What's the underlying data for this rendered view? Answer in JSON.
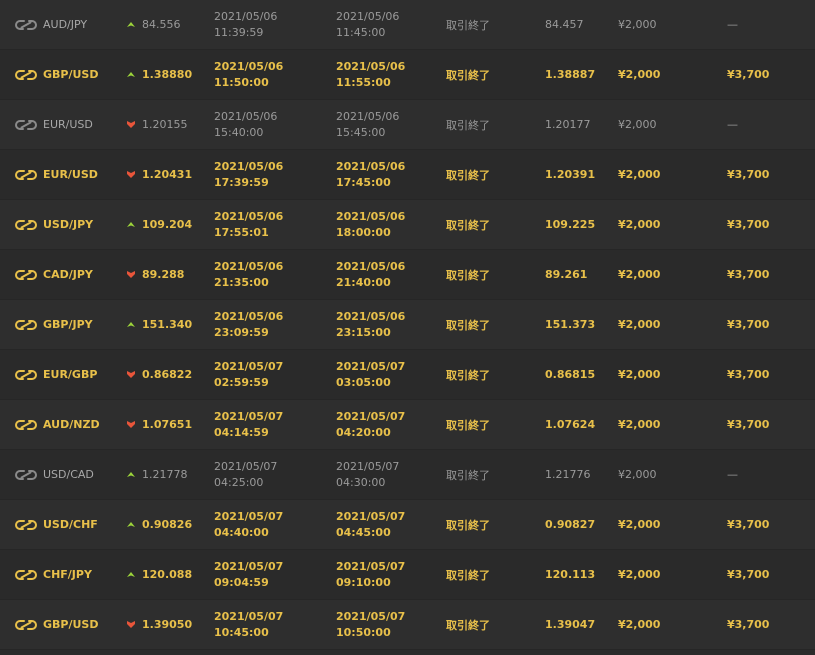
{
  "colors": {
    "background": "#2b2b2b",
    "win_text": "#e8c04a",
    "lose_text": "#9a9a9a",
    "up_arrow": "#9cd43a",
    "down_arrow": "#e8553a"
  },
  "rows": [
    {
      "result": "lose",
      "pair": "AUD/JPY",
      "direction": "up",
      "entry_rate": "84.556",
      "entry_date": "2021/05/06",
      "entry_time": "11:39:59",
      "expiry_date": "2021/05/06",
      "expiry_time": "11:45:00",
      "status": "取引終了",
      "close_rate": "84.457",
      "amount": "¥2,000",
      "payout": "—"
    },
    {
      "result": "win",
      "pair": "GBP/USD",
      "direction": "up",
      "entry_rate": "1.38880",
      "entry_date": "2021/05/06",
      "entry_time": "11:50:00",
      "expiry_date": "2021/05/06",
      "expiry_time": "11:55:00",
      "status": "取引終了",
      "close_rate": "1.38887",
      "amount": "¥2,000",
      "payout": "¥3,700"
    },
    {
      "result": "lose",
      "pair": "EUR/USD",
      "direction": "down",
      "entry_rate": "1.20155",
      "entry_date": "2021/05/06",
      "entry_time": "15:40:00",
      "expiry_date": "2021/05/06",
      "expiry_time": "15:45:00",
      "status": "取引終了",
      "close_rate": "1.20177",
      "amount": "¥2,000",
      "payout": "—"
    },
    {
      "result": "win",
      "pair": "EUR/USD",
      "direction": "down",
      "entry_rate": "1.20431",
      "entry_date": "2021/05/06",
      "entry_time": "17:39:59",
      "expiry_date": "2021/05/06",
      "expiry_time": "17:45:00",
      "status": "取引終了",
      "close_rate": "1.20391",
      "amount": "¥2,000",
      "payout": "¥3,700"
    },
    {
      "result": "win",
      "pair": "USD/JPY",
      "direction": "up",
      "entry_rate": "109.204",
      "entry_date": "2021/05/06",
      "entry_time": "17:55:01",
      "expiry_date": "2021/05/06",
      "expiry_time": "18:00:00",
      "status": "取引終了",
      "close_rate": "109.225",
      "amount": "¥2,000",
      "payout": "¥3,700"
    },
    {
      "result": "win",
      "pair": "CAD/JPY",
      "direction": "down",
      "entry_rate": "89.288",
      "entry_date": "2021/05/06",
      "entry_time": "21:35:00",
      "expiry_date": "2021/05/06",
      "expiry_time": "21:40:00",
      "status": "取引終了",
      "close_rate": "89.261",
      "amount": "¥2,000",
      "payout": "¥3,700"
    },
    {
      "result": "win",
      "pair": "GBP/JPY",
      "direction": "up",
      "entry_rate": "151.340",
      "entry_date": "2021/05/06",
      "entry_time": "23:09:59",
      "expiry_date": "2021/05/06",
      "expiry_time": "23:15:00",
      "status": "取引終了",
      "close_rate": "151.373",
      "amount": "¥2,000",
      "payout": "¥3,700"
    },
    {
      "result": "win",
      "pair": "EUR/GBP",
      "direction": "down",
      "entry_rate": "0.86822",
      "entry_date": "2021/05/07",
      "entry_time": "02:59:59",
      "expiry_date": "2021/05/07",
      "expiry_time": "03:05:00",
      "status": "取引終了",
      "close_rate": "0.86815",
      "amount": "¥2,000",
      "payout": "¥3,700"
    },
    {
      "result": "win",
      "pair": "AUD/NZD",
      "direction": "down",
      "entry_rate": "1.07651",
      "entry_date": "2021/05/07",
      "entry_time": "04:14:59",
      "expiry_date": "2021/05/07",
      "expiry_time": "04:20:00",
      "status": "取引終了",
      "close_rate": "1.07624",
      "amount": "¥2,000",
      "payout": "¥3,700"
    },
    {
      "result": "lose",
      "pair": "USD/CAD",
      "direction": "up",
      "entry_rate": "1.21778",
      "entry_date": "2021/05/07",
      "entry_time": "04:25:00",
      "expiry_date": "2021/05/07",
      "expiry_time": "04:30:00",
      "status": "取引終了",
      "close_rate": "1.21776",
      "amount": "¥2,000",
      "payout": "—"
    },
    {
      "result": "win",
      "pair": "USD/CHF",
      "direction": "up",
      "entry_rate": "0.90826",
      "entry_date": "2021/05/07",
      "entry_time": "04:40:00",
      "expiry_date": "2021/05/07",
      "expiry_time": "04:45:00",
      "status": "取引終了",
      "close_rate": "0.90827",
      "amount": "¥2,000",
      "payout": "¥3,700"
    },
    {
      "result": "win",
      "pair": "CHF/JPY",
      "direction": "up",
      "entry_rate": "120.088",
      "entry_date": "2021/05/07",
      "entry_time": "09:04:59",
      "expiry_date": "2021/05/07",
      "expiry_time": "09:10:00",
      "status": "取引終了",
      "close_rate": "120.113",
      "amount": "¥2,000",
      "payout": "¥3,700"
    },
    {
      "result": "win",
      "pair": "GBP/USD",
      "direction": "down",
      "entry_rate": "1.39050",
      "entry_date": "2021/05/07",
      "entry_time": "10:45:00",
      "expiry_date": "2021/05/07",
      "expiry_time": "10:50:00",
      "status": "取引終了",
      "close_rate": "1.39047",
      "amount": "¥2,000",
      "payout": "¥3,700"
    }
  ]
}
